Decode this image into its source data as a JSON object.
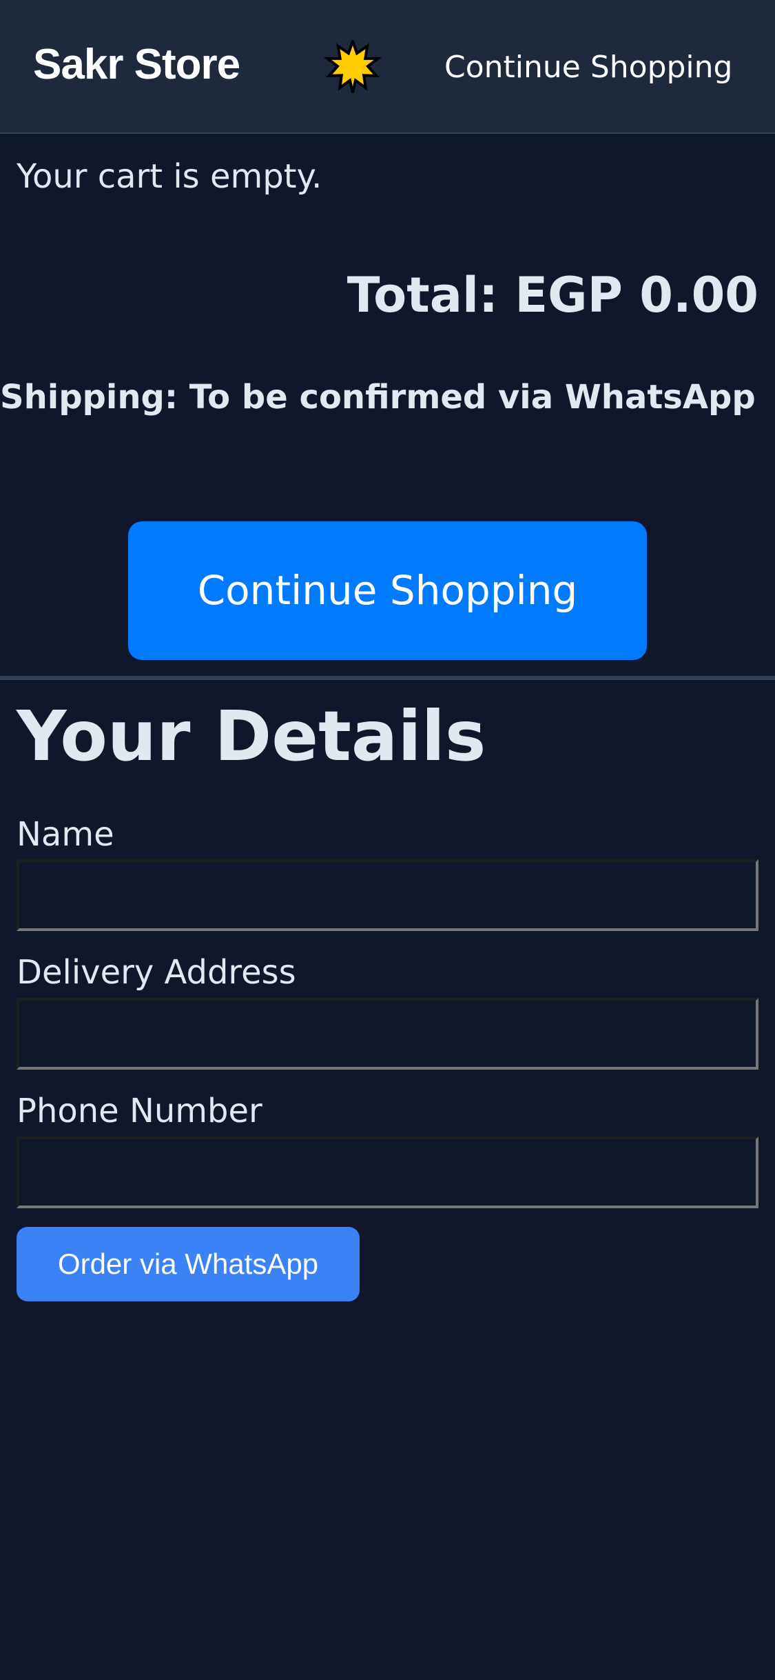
{
  "header": {
    "brand": "Sakr Store",
    "theme_icon": "sun-icon",
    "continue_link": "Continue Shopping"
  },
  "cart": {
    "empty_message": "Your cart is empty.",
    "total": "Total: EGP 0.00",
    "shipping": "Shipping: To be confirmed via WhatsApp",
    "continue_button": "Continue Shopping"
  },
  "details": {
    "title": "Your Details",
    "fields": [
      {
        "label": "Name",
        "value": "",
        "placeholder": ""
      },
      {
        "label": "Delivery Address",
        "value": "",
        "placeholder": ""
      },
      {
        "label": "Phone Number",
        "value": "",
        "placeholder": ""
      }
    ],
    "order_button": "Order via WhatsApp"
  },
  "colors": {
    "background": "#0f172a",
    "header_background": "#1e293b",
    "primary_button": "#007bff",
    "order_button": "#3b82f6",
    "sun_icon": "#ffcc00"
  }
}
